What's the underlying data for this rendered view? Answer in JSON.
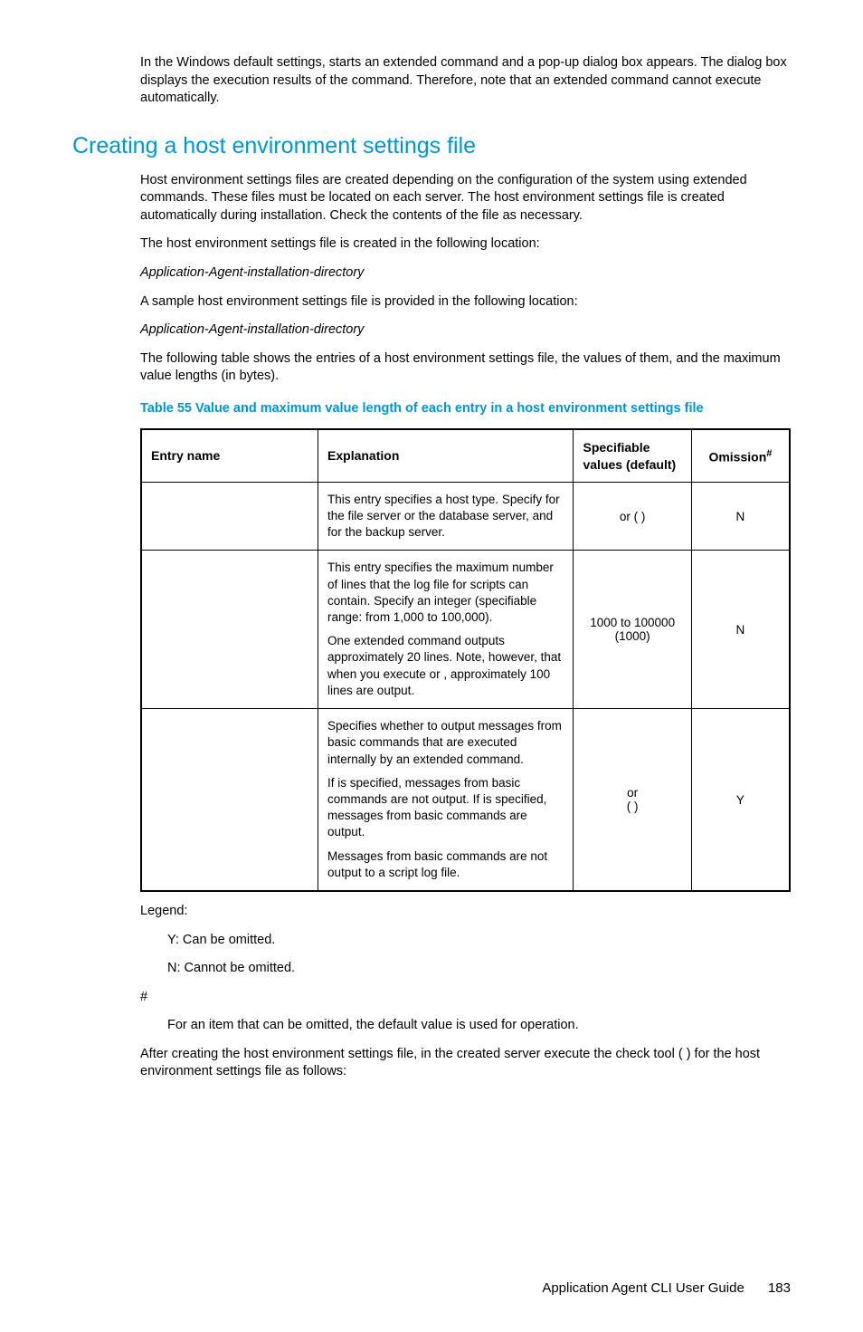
{
  "intro": {
    "p1_a": "In the Windows default settings, ",
    "p1_b": " starts an extended command and a pop-up dialog box appears. The dialog box displays the execution results of the command. Therefore, note that an extended command cannot execute automatically."
  },
  "section": {
    "heading": "Creating a host environment settings file",
    "p1": "Host environment settings files are created depending on the configuration of the system using extended commands. These files must be located on each server. The host environment settings file is created automatically during installation. Check the contents of the file as necessary.",
    "p2": "The host environment settings file is created in the following location:",
    "p3": "Application-Agent-installation-directory",
    "p4": "A sample host environment settings file is provided in the following location:",
    "p5": "Application-Agent-installation-directory",
    "p6": "The following table shows the entries of a host environment settings file, the values of them, and the maximum value lengths (in bytes).",
    "table_title": "Table 55 Value and maximum value length of each entry in a host environment settings file"
  },
  "table": {
    "headers": {
      "c1": "Entry name",
      "c2": "Explanation",
      "c3": "Specifiable values (default)",
      "c4_a": "Omission",
      "c4_b": "#"
    },
    "rows": [
      {
        "entry": "",
        "explanation_parts": {
          "a": "This entry specifies a host type. Specify ",
          "b": " for the file server or the database server, and ",
          "c": " for the backup server."
        },
        "spec": {
          "a": "",
          "b": " or ",
          "c": " (",
          "d": ")"
        },
        "omission": "N"
      },
      {
        "entry": "",
        "explanation_parts": {
          "a": "This entry specifies the maximum number of lines that the log file for scripts can contain. Specify an integer (specifiable range: from 1,000 to 100,000).",
          "b": "One extended command outputs approximately 20 lines. Note, however, that when you execute ",
          "c": " or ",
          "d": ", approximately 100 lines are output."
        },
        "spec": {
          "a": "1000 to 100000 (1000)"
        },
        "omission": "N"
      },
      {
        "entry": "",
        "explanation_parts": {
          "a": "Specifies whether to output messages from basic commands that are executed internally by an extended command.",
          "b": "If ",
          "c": " is specified, messages from basic commands are not output. If ",
          "d": " is specified, messages from basic commands are output.",
          "e": "Messages from basic commands are not output to a script log file."
        },
        "spec": {
          "a": "",
          "b": " or ",
          "c": " (",
          "d": ")"
        },
        "omission": "Y"
      }
    ]
  },
  "legend": {
    "title": "Legend:",
    "y": "Y: Can be omitted.",
    "n": "N: Cannot be omitted.",
    "hash": "#",
    "hash_text": "For an item that can be omitted, the default value is used for operation."
  },
  "after": {
    "p1_a": "After creating the host environment settings file, in the created server execute the check tool (",
    "p1_b": ") for the host environment settings file as follows:"
  },
  "footer": {
    "title": "Application Agent CLI User Guide",
    "page": "183"
  }
}
